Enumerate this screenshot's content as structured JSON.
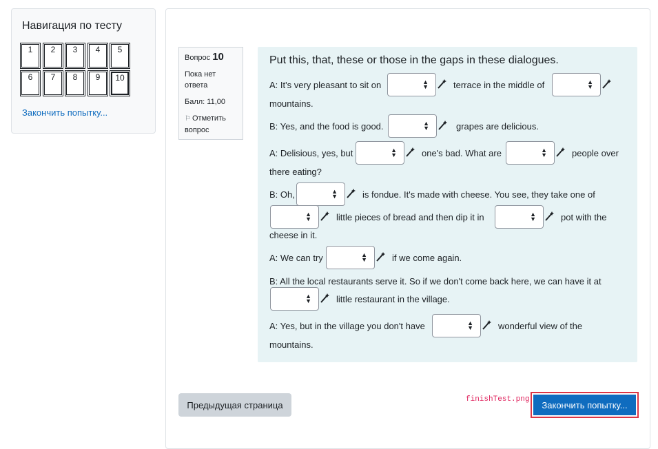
{
  "nav": {
    "title": "Навигация по тесту",
    "buttons": [
      "1",
      "2",
      "3",
      "4",
      "5",
      "6",
      "7",
      "8",
      "9",
      "10"
    ],
    "finish_link": "Закончить попытку..."
  },
  "question_info": {
    "label": "Вопрос",
    "number": "10",
    "state": "Пока нет ответа",
    "grade": "Балл: 11,00",
    "flag": "Отметить вопрос"
  },
  "question": {
    "prompt": "Put this, that, these or those in the gaps in these dialogues.",
    "texts": {
      "t1": "A: It's very pleasant to sit on",
      "t2": "terrace in the middle of",
      "t3": "mountains.",
      "t4": "B: Yes, and the food is good.",
      "t5": "grapes are delicious.",
      "t6": "A: Delisious, yes, but",
      "t7": "one's bad. What are",
      "t8": "people over",
      "t9": "there eating?",
      "t10": "B: Oh,",
      "t11": "is fondue. It's made with cheese. You see, they take one of",
      "t12": "little pieces of bread and then dip it in",
      "t13": "pot with the",
      "t14": "cheese in it.",
      "t15": "A: We can try",
      "t16": "if we come again.",
      "t17": "B: All the local restaurants serve it. So if we don't come back here, we can have it at",
      "t18": "little restaurant in the village.",
      "t19": "A: Yes, but in the village you don't have",
      "t20": "wonderful view of the",
      "t21": "mountains."
    },
    "blank_value": ""
  },
  "footer": {
    "prev_button": "Предыдущая страница",
    "finish_button": "Закончить попытку...",
    "note": "finishTest.png"
  }
}
